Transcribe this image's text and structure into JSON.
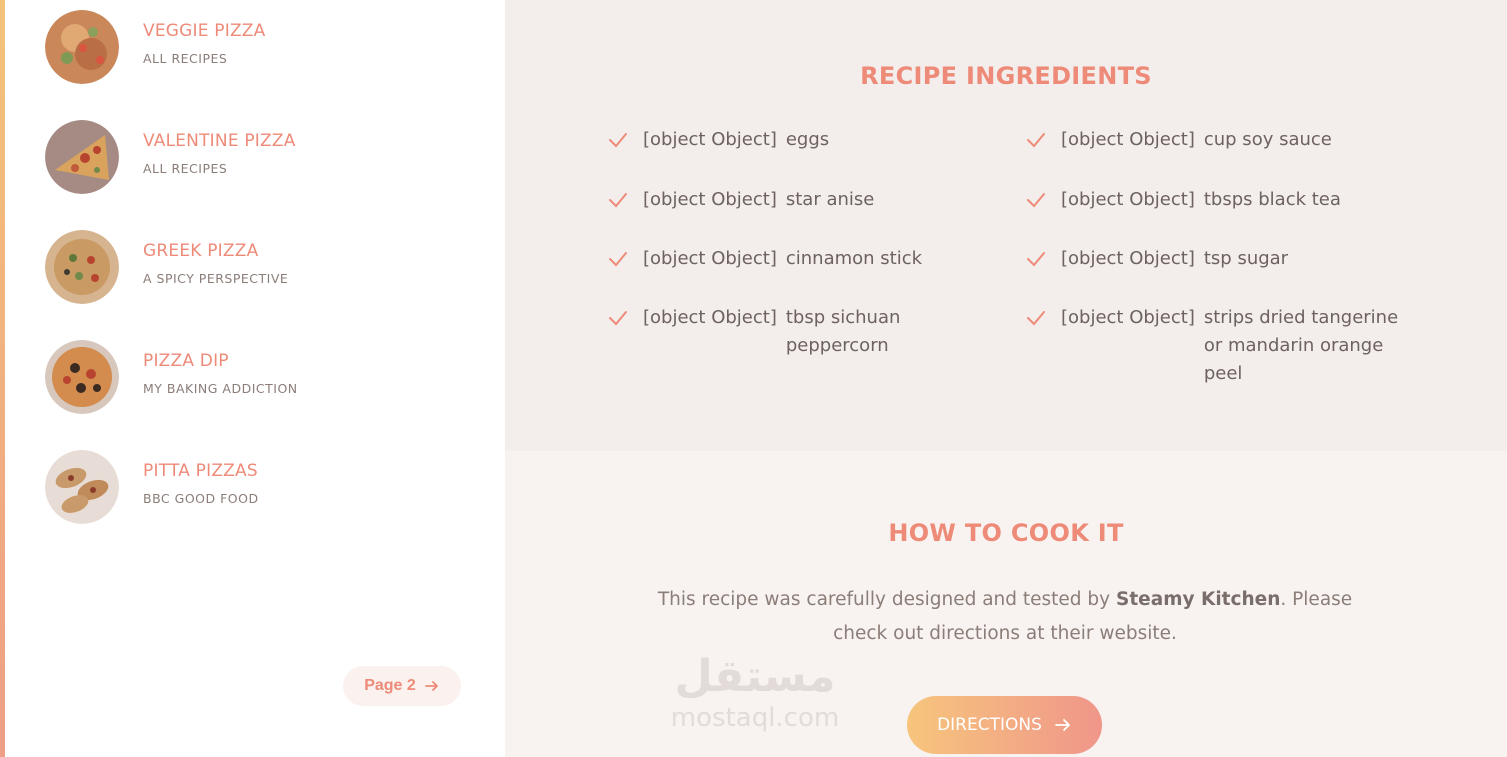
{
  "colors": {
    "accent": "#ee8a78",
    "accent_gradient_start": "#f6c57c",
    "accent_gradient_end": "#f0968a"
  },
  "sidebar": {
    "recipes": [
      {
        "title": "VEGGIE PIZZA",
        "source": "ALL RECIPES"
      },
      {
        "title": "VALENTINE PIZZA",
        "source": "ALL RECIPES"
      },
      {
        "title": "GREEK PIZZA",
        "source": "A SPICY PERSPECTIVE"
      },
      {
        "title": "PIZZA DIP",
        "source": "MY BAKING ADDICTION"
      },
      {
        "title": "PITTA PIZZAS",
        "source": "BBC GOOD FOOD"
      }
    ],
    "page_button": {
      "label": "Page 2",
      "icon": "arrow-right-icon"
    }
  },
  "ingredients": {
    "heading": "RECIPE INGREDIENTS",
    "items": [
      {
        "amount": "[object Object]",
        "name": "eggs"
      },
      {
        "amount": "[object Object]",
        "name": "cup soy sauce"
      },
      {
        "amount": "[object Object]",
        "name": "star anise"
      },
      {
        "amount": "[object Object]",
        "name": "tbsps black tea"
      },
      {
        "amount": "[object Object]",
        "name": "cinnamon stick"
      },
      {
        "amount": "[object Object]",
        "name": "tsp sugar"
      },
      {
        "amount": "[object Object]",
        "name": "tbsp sichuan peppercorn"
      },
      {
        "amount": "[object Object]",
        "name": "strips dried tangerine or mandarin orange peel"
      }
    ]
  },
  "cook": {
    "heading": "HOW TO COOK IT",
    "text_before": "This recipe was carefully designed and tested by ",
    "author": "Steamy Kitchen",
    "text_after": ". Please check out directions at their website.",
    "button_label": "DIRECTIONS"
  },
  "watermark": {
    "arabic": "مستقل",
    "latin": "mostaql.com"
  }
}
